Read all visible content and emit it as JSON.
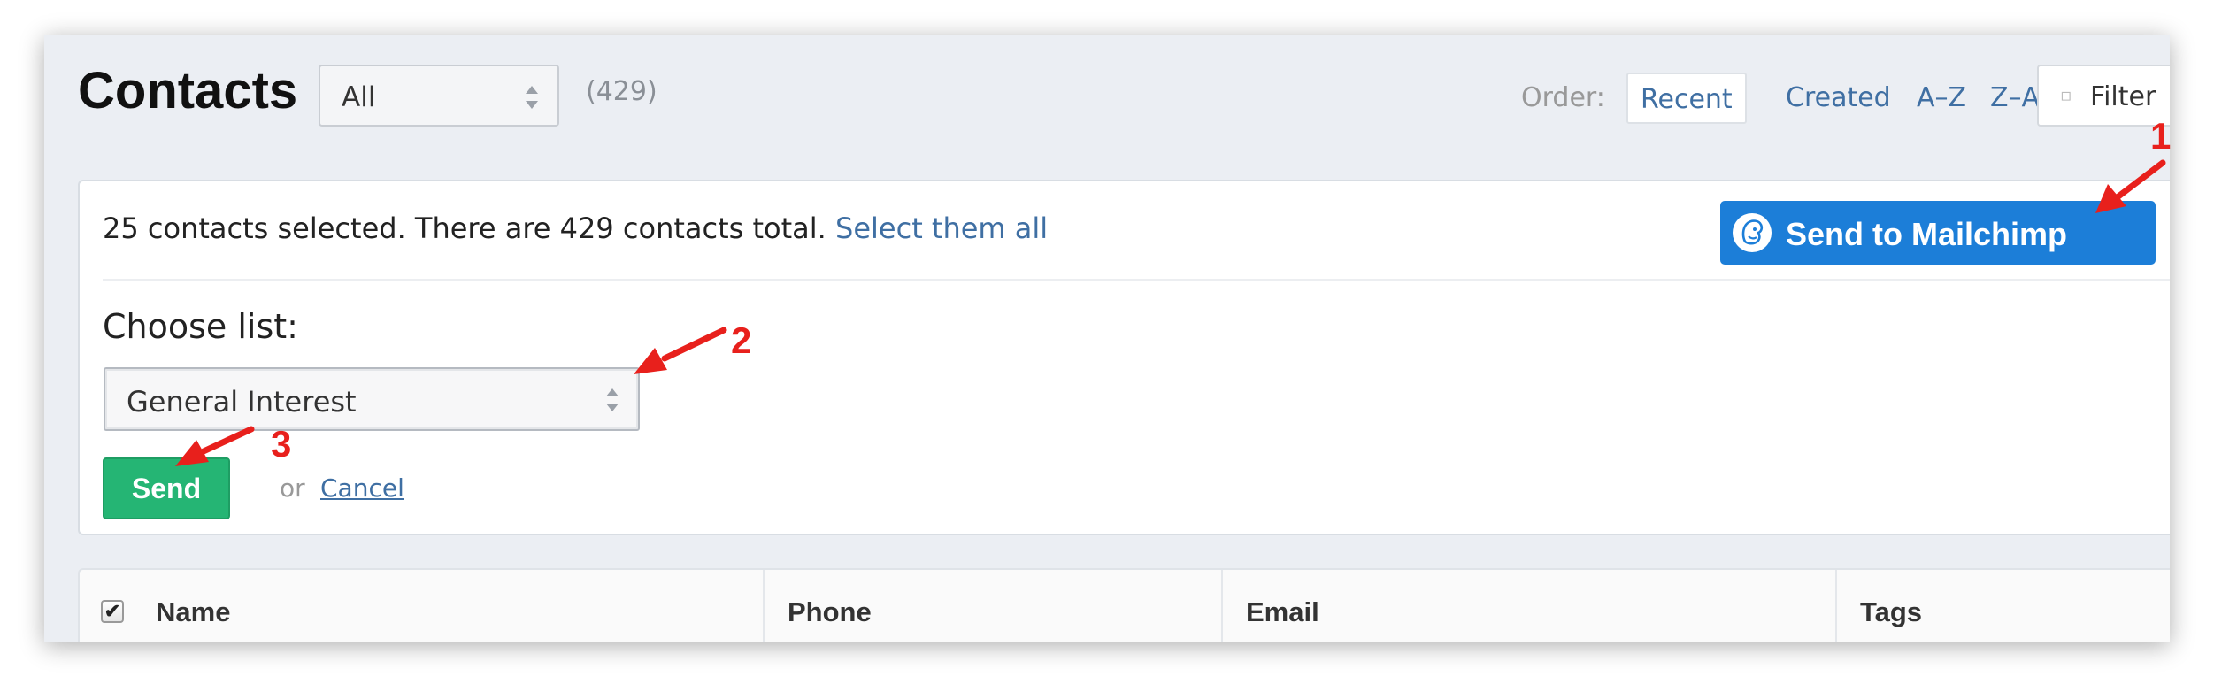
{
  "header": {
    "title": "Contacts",
    "list_filter_value": "All",
    "count": "(429)",
    "order_label": "Order:",
    "order_options": [
      "Recent",
      "Created",
      "A–Z",
      "Z–A"
    ],
    "filter_label": "Filter"
  },
  "selection": {
    "message": "25 contacts selected. There are 429 contacts total.",
    "select_all_link": "Select them all"
  },
  "mailchimp_button": {
    "label": "Send to Mailchimp"
  },
  "send_form": {
    "choose_label": "Choose list:",
    "list_value": "General Interest",
    "send_label": "Send",
    "or_text": "or",
    "cancel_label": "Cancel"
  },
  "table": {
    "checkbox_mark": "✔",
    "columns": [
      "Name",
      "Phone",
      "Email",
      "Tags"
    ]
  },
  "annotations": {
    "step1": "1",
    "step2": "2",
    "step3": "3",
    "arrow_color": "#e8201c"
  },
  "colors": {
    "link": "#3f6fa3",
    "mailchimp_blue": "#1c7ed8",
    "send_green": "#25b574"
  }
}
